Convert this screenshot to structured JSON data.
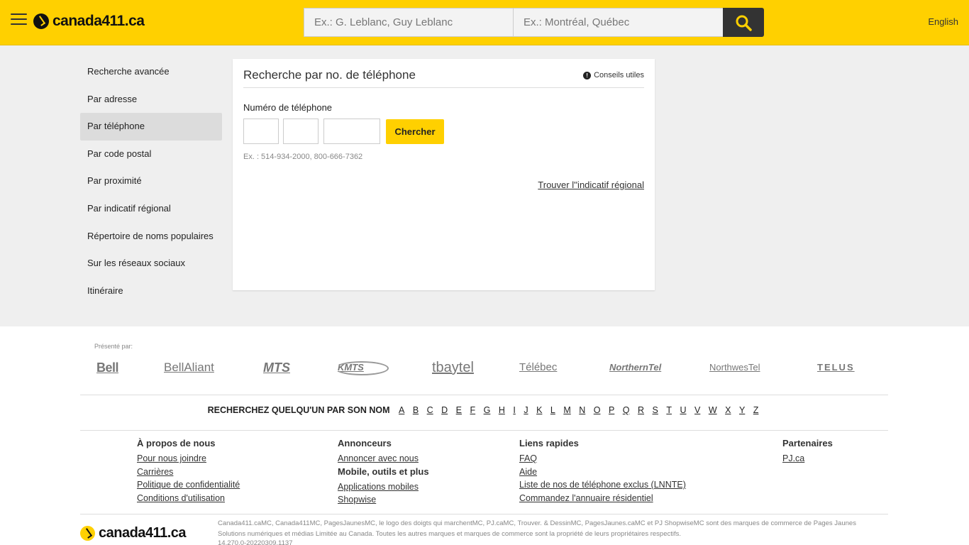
{
  "header": {
    "logo_text": "canada411.ca",
    "search_who_placeholder": "Ex.: G. Leblanc, Guy Leblanc",
    "search_where_placeholder": "Ex.: Montréal, Québec",
    "language": "English",
    "accent_color": "#ffd000"
  },
  "sidenav": {
    "items": [
      {
        "label": "Recherche avancée"
      },
      {
        "label": "Par adresse"
      },
      {
        "label": "Par téléphone",
        "active": true
      },
      {
        "label": "Par code postal"
      },
      {
        "label": "Par proximité"
      },
      {
        "label": "Par indicatif régional"
      },
      {
        "label": "Répertoire de noms populaires"
      },
      {
        "label": "Sur les réseaux sociaux"
      },
      {
        "label": "Itinéraire"
      }
    ]
  },
  "card": {
    "title": "Recherche par no. de téléphone",
    "tips_label": "Conseils utiles",
    "phone_label": "Numéro de téléphone",
    "search_button": "Chercher",
    "example": "Ex. : 514-934-2000, 800-666-7362",
    "area_code_link": "Trouver l''indicatif régional"
  },
  "presented_by": {
    "label": "Présenté par:",
    "partners": [
      "Bell",
      "BellAliant",
      "MTS",
      "KMTS",
      "tbaytel",
      "Télébec",
      "NorthernTel",
      "NorthwesTel",
      "TELUS"
    ]
  },
  "alphabet": {
    "title": "RECHERCHEZ QUELQU'UN PAR SON NOM",
    "letters": [
      "A",
      "B",
      "C",
      "D",
      "E",
      "F",
      "G",
      "H",
      "I",
      "J",
      "K",
      "L",
      "M",
      "N",
      "O",
      "P",
      "Q",
      "R",
      "S",
      "T",
      "U",
      "V",
      "W",
      "X",
      "Y",
      "Z"
    ]
  },
  "footer": {
    "about": {
      "heading": "À propos de nous",
      "links": [
        "Pour nous joindre",
        "Carrières",
        "Politique de confidentialité",
        "Conditions d'utilisation"
      ]
    },
    "advertisers": {
      "heading": "Annonceurs",
      "links": [
        "Annoncer avec nous"
      ],
      "subheading": "Mobile, outils et plus",
      "sublinks": [
        "Applications mobiles",
        "Shopwise"
      ]
    },
    "quick_links": {
      "heading": "Liens rapides",
      "links": [
        "FAQ",
        "Aide",
        "Liste de nos de téléphone exclus (LNNTE)",
        "Commandez l'annuaire résidentiel"
      ]
    },
    "partners": {
      "heading": "Partenaires",
      "links": [
        "PJ.ca"
      ]
    },
    "logo_text": "canada411.ca",
    "legal": "Canada411.caMC, Canada411MC, PagesJaunesMC, le logo des doigts qui marchentMC, PJ.caMC, Trouver. & DessinMC, PagesJaunes.caMC et PJ ShopwiseMC sont des marques de commerce de Pages Jaunes Solutions numériques et médias Limitée au Canada. Toutes les autres marques et marques de commerce sont la propriété de leurs propriétaires respectifs.",
    "version": "14.270.0-20220309.1137"
  }
}
